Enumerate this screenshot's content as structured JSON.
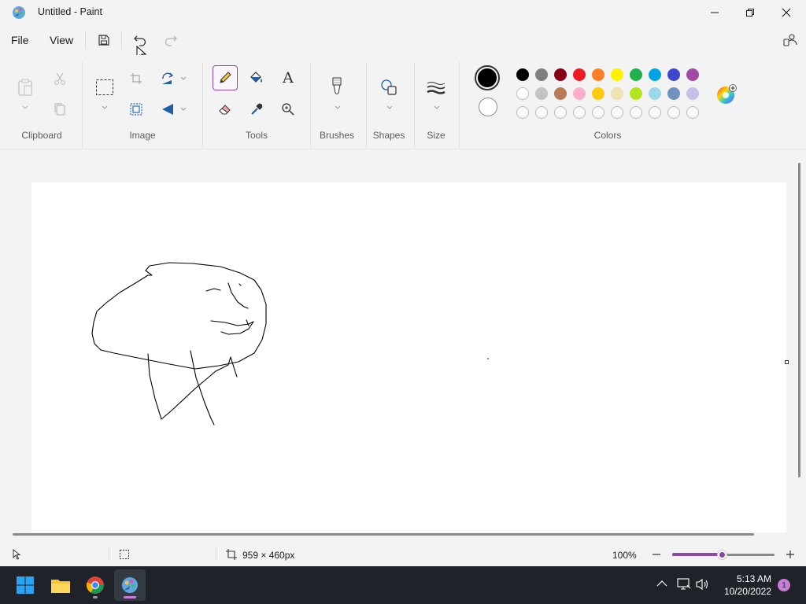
{
  "window": {
    "title": "Untitled - Paint"
  },
  "menubar": {
    "file_label": "File",
    "view_label": "View"
  },
  "ribbon": {
    "groups": {
      "clipboard": "Clipboard",
      "image": "Image",
      "tools": "Tools",
      "brushes": "Brushes",
      "shapes": "Shapes",
      "size": "Size",
      "colors": "Colors"
    },
    "tools": {
      "text_glyph": "A"
    },
    "colors": {
      "primary": "#000000",
      "secondary": "#ffffff",
      "palette_row1": [
        "#000000",
        "#7f7f7f",
        "#880015",
        "#ed1c24",
        "#ff7f27",
        "#fff200",
        "#22b14c",
        "#00a2e8",
        "#3f48cc",
        "#a349a4"
      ],
      "palette_row2": [
        "#ffffff",
        "#c3c3c3",
        "#b97a57",
        "#ffaec9",
        "#ffc90e",
        "#efe4b0",
        "#b5e61d",
        "#99d9ea",
        "#7092be",
        "#c8bfe7"
      ]
    }
  },
  "status": {
    "canvas_size": "959 × 460px",
    "zoom": "100%",
    "zoom_level": 0.5
  },
  "taskbar": {
    "time": "5:13 AM",
    "date": "10/20/2022",
    "notification_count": "1"
  }
}
